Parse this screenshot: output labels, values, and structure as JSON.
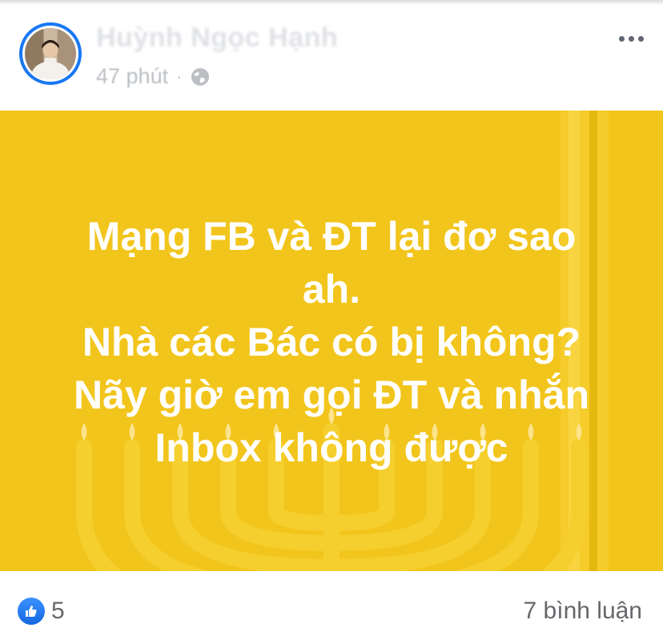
{
  "post": {
    "author_name": "Huỳnh Ngọc Hạnh",
    "time": "47 phút",
    "separator": "·",
    "privacy_icon": "globe-icon",
    "more_icon": "more-options-icon",
    "background_color": "#f2c51c",
    "text_lines": [
      "Mạng FB và ĐT lại đơ sao",
      "ah.",
      "Nhà các Bác có bị không?",
      "Nãy giờ em gọi ĐT và nhắn",
      "Inbox không được"
    ]
  },
  "footer": {
    "reaction_icon": "like-icon",
    "reaction_count": "5",
    "comments_label": "7 bình luận"
  },
  "colors": {
    "accent": "#1877f2",
    "text_secondary": "#65676b"
  }
}
